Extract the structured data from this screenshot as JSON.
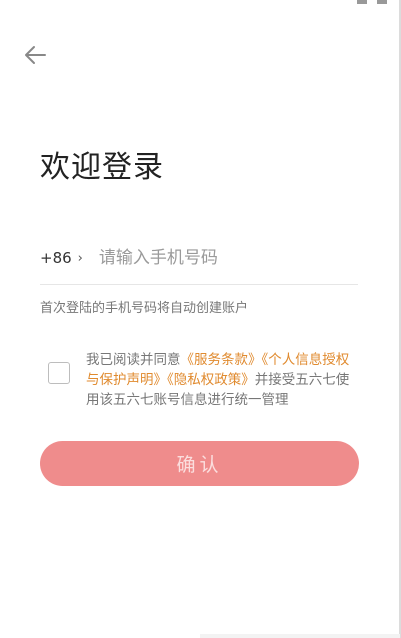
{
  "header": {
    "back_icon": "arrow-left-icon"
  },
  "title": "欢迎登录",
  "phone": {
    "country_code": "+86",
    "chevron": "›",
    "placeholder": "请输入手机号码",
    "value": ""
  },
  "hint": "首次登陆的手机号码将自动创建账户",
  "agreement": {
    "prefix": "我已阅读并同意",
    "terms_link": "《服务条款》",
    "privacy_auth_link": "《个人信息授权与保护声明》",
    "privacy_policy_link": "《隐私权政策》",
    "suffix": "并接受五六七使用该五六七账号信息进行统一管理",
    "checked": false
  },
  "confirm_label": "确认",
  "colors": {
    "accent": "#ef8c8c",
    "link": "#e08a2e"
  }
}
